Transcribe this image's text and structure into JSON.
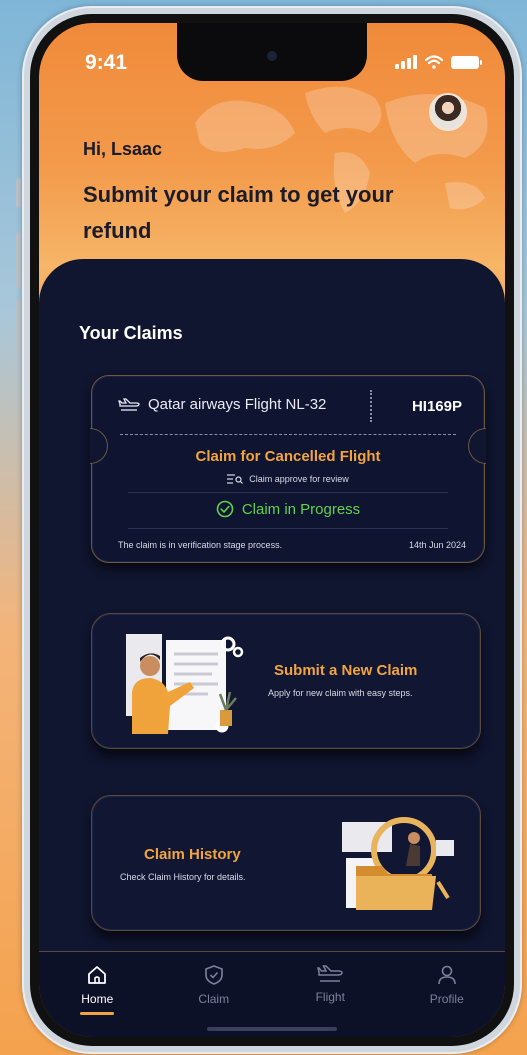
{
  "status_bar": {
    "time": "9:41"
  },
  "header": {
    "greeting": "Hi, Lsaac",
    "headline": "Submit your claim to get your refund"
  },
  "claims": {
    "section_title": "Your Claims",
    "ticket": {
      "flight": "Qatar airways Flight NL-32",
      "code": "HI169P",
      "title": "Claim for Cancelled Flight",
      "subtitle": "Claim approve for review",
      "status": "Claim in Progress",
      "note": "The claim is in verification stage process.",
      "date": "14th Jun 2024"
    }
  },
  "new_claim": {
    "title": "Submit a New Claim",
    "description": "Apply for new claim with easy steps."
  },
  "history": {
    "title": "Claim History",
    "description": "Check Claim History for details."
  },
  "tabbar": {
    "items": [
      {
        "label": "Home",
        "icon": "home-icon",
        "active": true
      },
      {
        "label": "Claim",
        "icon": "shield-icon",
        "active": false
      },
      {
        "label": "Flight",
        "icon": "plane-icon",
        "active": false
      },
      {
        "label": "Profile",
        "icon": "user-icon",
        "active": false
      }
    ]
  },
  "colors": {
    "accent": "#f2a53f",
    "panel": "#101530",
    "success": "#62d14c",
    "header_gradient_top": "#f08a3a"
  }
}
